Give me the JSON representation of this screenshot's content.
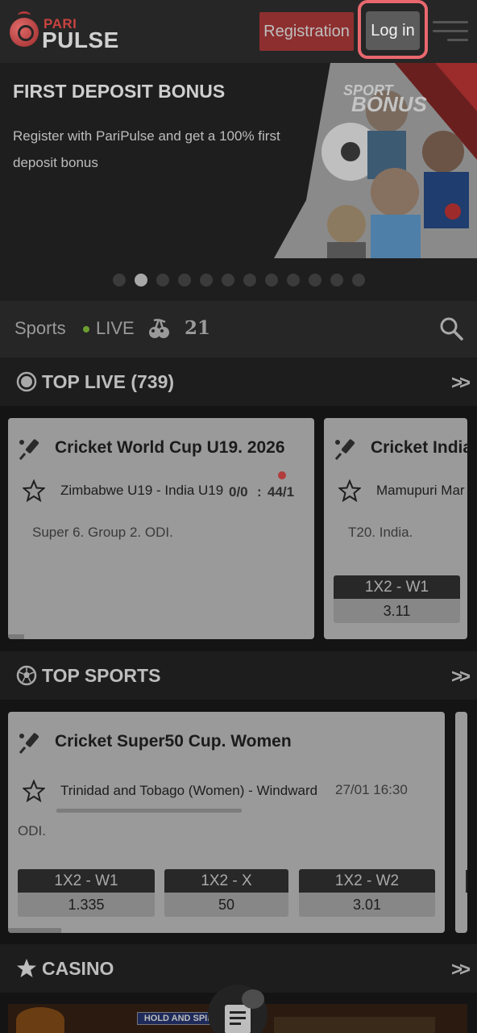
{
  "header": {
    "logo_top": "PARI",
    "logo_bottom": "PULSE",
    "registration_label": "Registration",
    "login_label": "Log in"
  },
  "banner": {
    "title": "FIRST DEPOSIT BONUS",
    "text": "Register with PariPulse and get a 100% first deposit bonus",
    "art_caption_top": "SPORT",
    "art_caption_bottom": "BONUS",
    "slides_count": 12,
    "active_slide": 1
  },
  "nav": {
    "sports_label": "Sports",
    "live_label": "LIVE",
    "games_label": "21"
  },
  "top_live": {
    "title": "TOP LIVE (739)",
    "cards": [
      {
        "league": "Cricket World Cup U19. 2026",
        "teams": "Zimbabwe U19 - India U19",
        "score_home": "0/0",
        "score_sep": ":",
        "score_away": "44/1",
        "description": "Super 6. Group 2. ODI."
      },
      {
        "league": "Cricket India",
        "teams": "Mamupuri Mar",
        "description": "T20. India.",
        "odds": [
          {
            "label": "1X2 - W1",
            "value": "3.11"
          }
        ]
      }
    ]
  },
  "top_sports": {
    "title": "TOP SPORTS",
    "cards": [
      {
        "league": "Cricket Super50 Cup. Women",
        "teams": "Trinidad and Tobago (Women) - Windward",
        "datetime": "27/01 16:30",
        "description": "ODI.",
        "odds": [
          {
            "label": "1X2 - W1",
            "value": "1.335"
          },
          {
            "label": "1X2 - X",
            "value": "50"
          },
          {
            "label": "1X2 - W2",
            "value": "3.01"
          }
        ]
      }
    ]
  },
  "casino": {
    "title": "CASINO",
    "strip_text": "HOLD AND SPIN"
  },
  "colors": {
    "registration_bg": "#8d2f2f",
    "login_highlight": "#e8686e",
    "live_dot": "#6b9e2f"
  }
}
